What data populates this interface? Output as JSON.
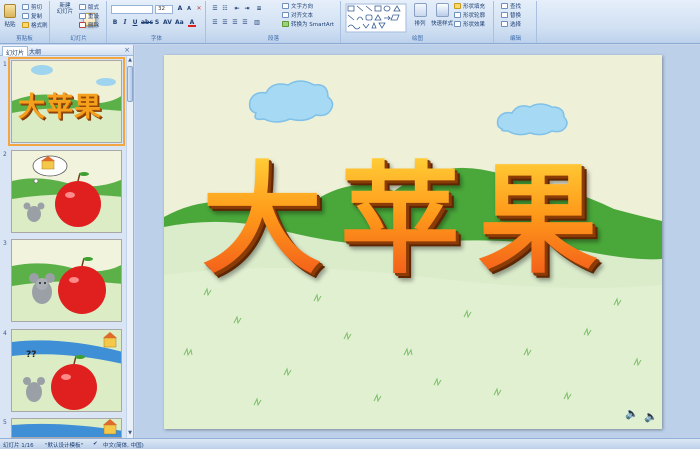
{
  "ribbon": {
    "clipboard": {
      "paste": "粘贴",
      "cut": "剪切",
      "copy": "复制",
      "format_painter": "格式刷",
      "label": "剪贴板"
    },
    "slides": {
      "new_slide": "新建\n幻灯片",
      "layout": "版式",
      "reset": "重设",
      "delete": "删除",
      "label": "幻灯片"
    },
    "font": {
      "font_name": "",
      "font_size": "32",
      "label": "字体"
    },
    "paragraph": {
      "text_direction": "文字方向",
      "align_text": "对齐文本",
      "smartart": "转换为 SmartArt",
      "label": "段落"
    },
    "drawing": {
      "arrange": "排列",
      "quick_styles": "快速样式",
      "shape_fill": "形状填充",
      "shape_outline": "形状轮廓",
      "shape_effects": "形状效果",
      "label": "绘图"
    },
    "editing": {
      "find": "查找",
      "replace": "替换",
      "select": "选择",
      "label": "编辑"
    }
  },
  "pane": {
    "tab_slides": "幻灯片",
    "tab_outline": "大纲",
    "thumbs": [
      {
        "num": "1",
        "title": "大苹果"
      },
      {
        "num": "2"
      },
      {
        "num": "3"
      },
      {
        "num": "4",
        "question": "??"
      },
      {
        "num": "5"
      }
    ]
  },
  "slide": {
    "title": "大苹果"
  },
  "status": {
    "slide_info": "幻灯片 1/16",
    "theme": "\"默认设计模板\"",
    "language": "中文(简体, 中国)"
  },
  "colors": {
    "ribbon": "#d6e4f5",
    "accent": "#f2a540",
    "title_orange": "#f79d1c",
    "grass": "#4aa83a"
  }
}
